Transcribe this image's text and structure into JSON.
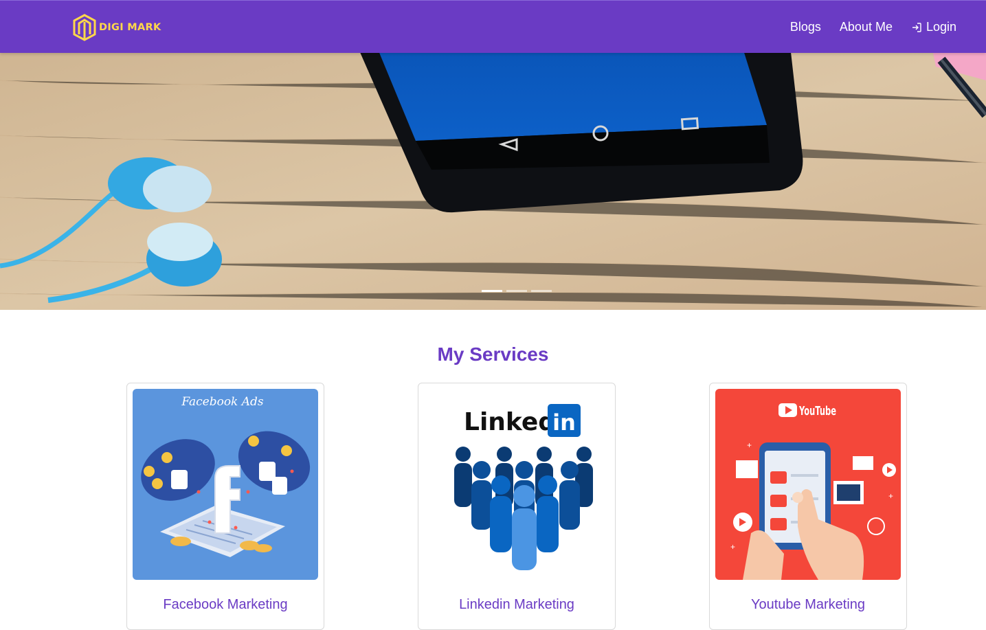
{
  "navbar": {
    "brand": "DIGI MARK",
    "links": [
      {
        "label": "Blogs"
      },
      {
        "label": "About Me"
      },
      {
        "label": "Login",
        "icon": "login-icon"
      }
    ]
  },
  "hero": {
    "slides": 3,
    "active_slide": 1
  },
  "services": {
    "title": "My Services",
    "items": [
      {
        "label": "Facebook Marketing",
        "image_caption": "Facebook Ads"
      },
      {
        "label": "Linkedin Marketing",
        "image_caption": "Linked in"
      },
      {
        "label": "Youtube Marketing",
        "image_caption": "YouTube"
      }
    ]
  },
  "colors": {
    "navbar": "#6a3bc4",
    "brand": "#ffd84a",
    "accent": "#6a3bc4",
    "facebook_bg": "#5b95dd",
    "youtube_bg": "#f4473a",
    "linkedin_blue": "#0a66c2"
  }
}
